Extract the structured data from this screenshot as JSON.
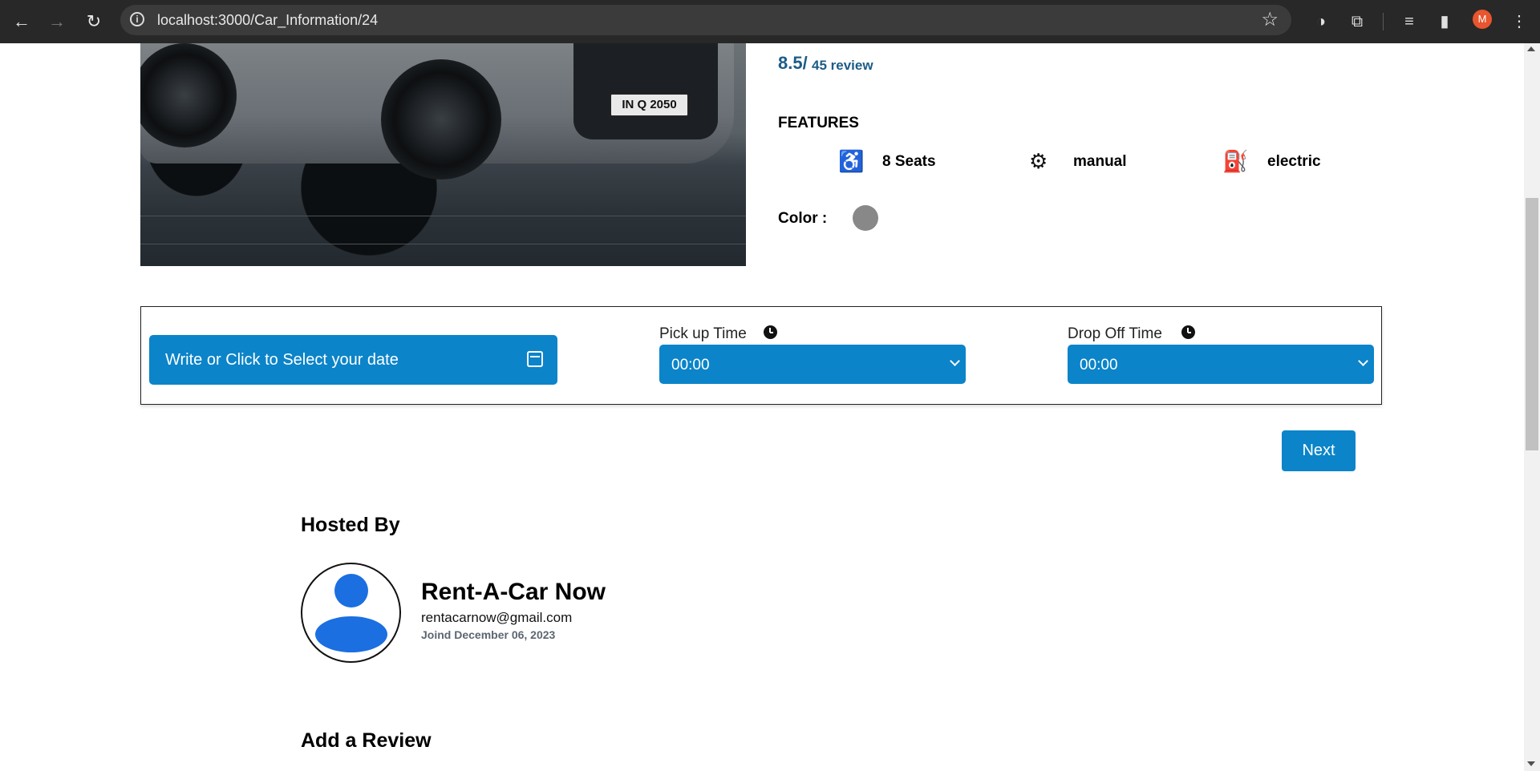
{
  "browser": {
    "url": "localhost:3000/Car_Information/24",
    "profile_initial": "M"
  },
  "car": {
    "plate_text": "IN Q 2050"
  },
  "rating": {
    "score": "8.5/",
    "count": "45 review"
  },
  "features": {
    "title": "FEATURES",
    "items": [
      {
        "label": "8 Seats",
        "icon": "seat-icon"
      },
      {
        "label": "manual",
        "icon": "gearbox-icon"
      },
      {
        "label": "electric",
        "icon": "ev-fuel-icon"
      }
    ],
    "color_label": "Color :",
    "color_value": "#888888"
  },
  "booking": {
    "date_placeholder": "Write or Click to Select your date",
    "pickup_label": "Pick up Time",
    "pickup_value": "00:00",
    "dropoff_label": "Drop Off Time",
    "dropoff_value": "00:00",
    "next_label": "Next"
  },
  "host": {
    "section_title": "Hosted By",
    "name": "Rent-A-Car Now",
    "email": "rentacarnow@gmail.com",
    "joined": "Joind December 06, 2023"
  },
  "review": {
    "section_title": "Add a Review"
  },
  "colors": {
    "primary": "#0b84c9",
    "rating_text": "#1c5c87",
    "avatar_blue": "#1b6fe0"
  }
}
